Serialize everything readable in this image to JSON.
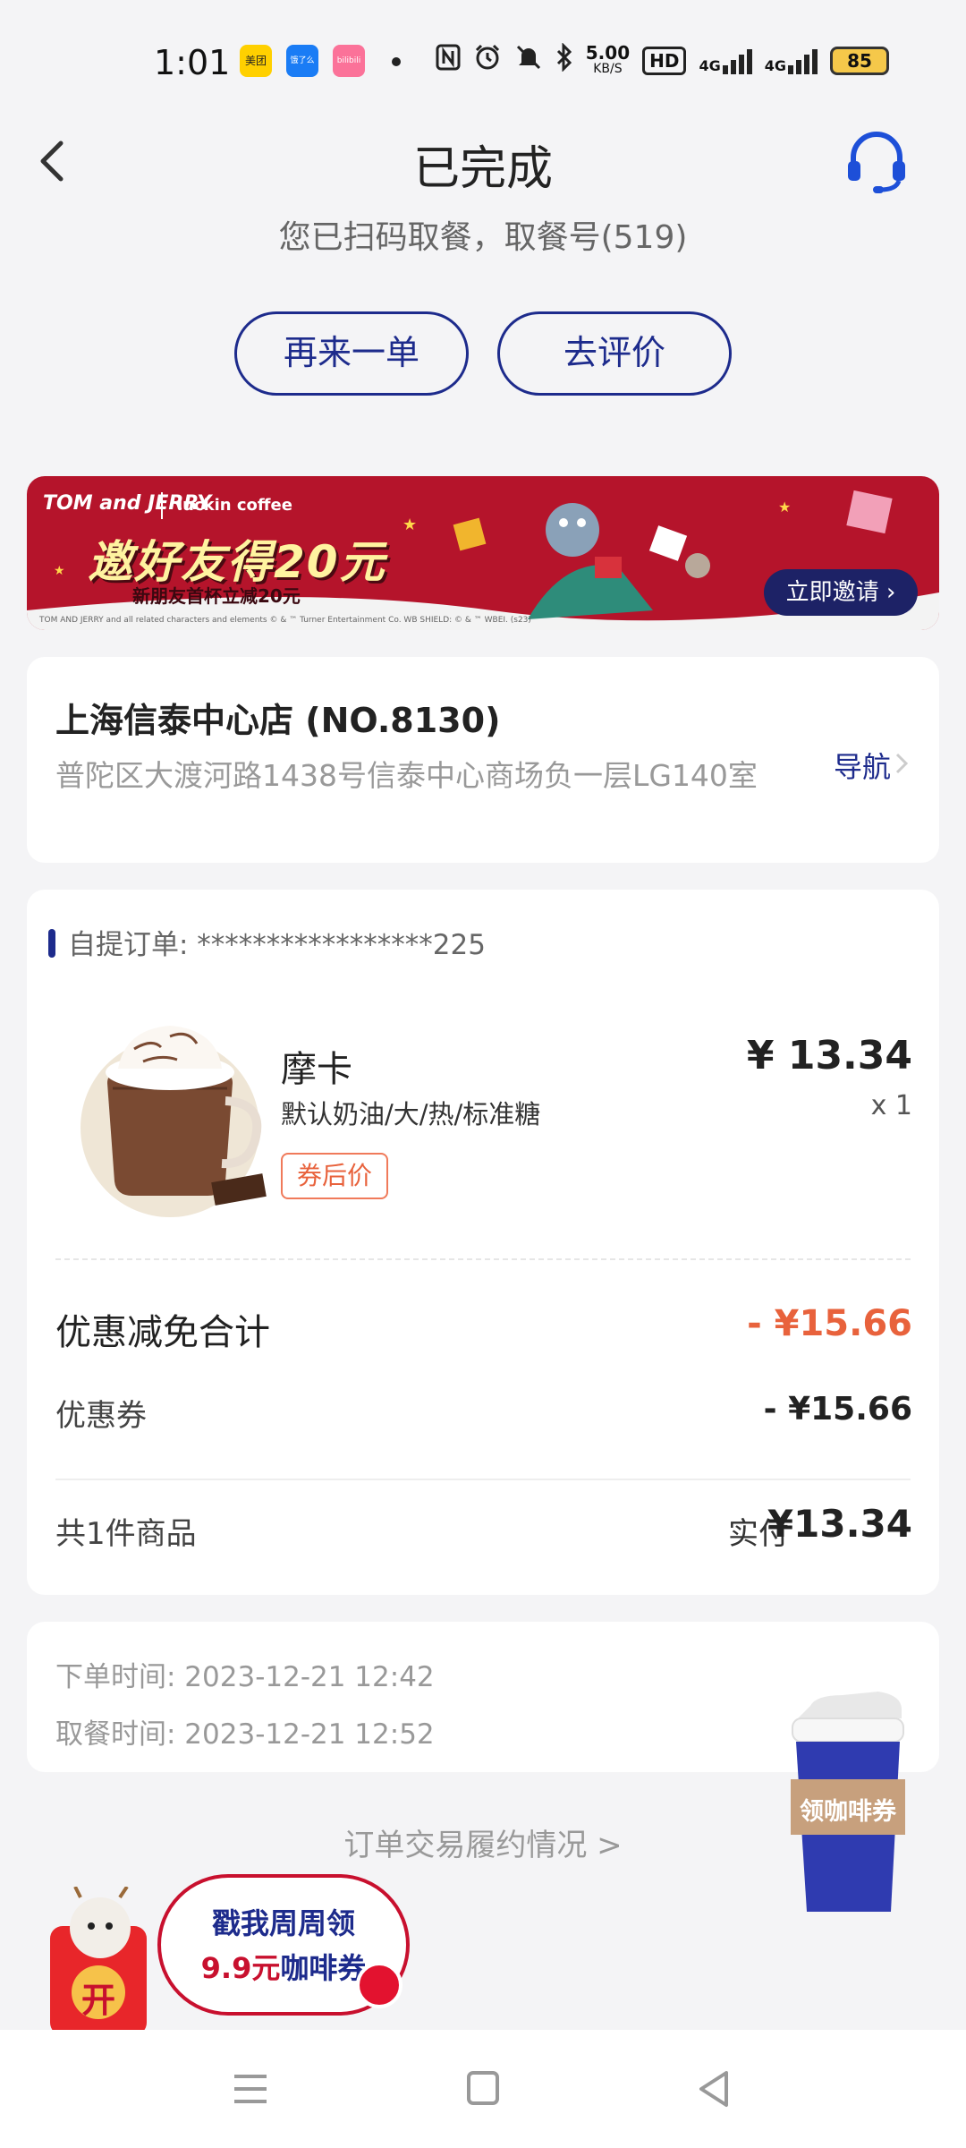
{
  "status_bar": {
    "time": "1:01",
    "apps": [
      "美团",
      "饿了么",
      "bilibili"
    ],
    "net_speed_value": "5.00",
    "net_speed_unit": "KB/S",
    "hd_label": "HD",
    "signal1": "4G",
    "signal2": "4G",
    "battery": "85"
  },
  "header": {
    "title": "已完成",
    "subtitle": "您已扫码取餐，取餐号(519)",
    "reorder_label": "再来一单",
    "review_label": "去评价"
  },
  "banner": {
    "brand_left": "TOM and JERRY",
    "brand_right": "luckin coffee",
    "title": "邀好友得20元",
    "subtitle": "新朋友首杯立减20元",
    "cta": "立即邀请",
    "legal": "TOM AND JERRY and all related characters and elements © & ™ Turner Entertainment Co. WB SHIELD: © & ™ WBEI. (s23)"
  },
  "store": {
    "name": "上海信泰中心店 (NO.8130)",
    "address": "普陀区大渡河路1438号信泰中心商场负一层LG140室",
    "nav_label": "导航"
  },
  "order": {
    "label": "自提订单: *****************225",
    "product": {
      "name": "摩卡",
      "spec": "默认奶油/大/热/标准糖",
      "tag": "券后价",
      "price": "¥ 13.34",
      "qty": "x 1"
    },
    "discount_total_label": "优惠减免合计",
    "discount_total_value": "- ¥15.66",
    "coupon_label": "优惠券",
    "coupon_value": "- ¥15.66",
    "item_count": "共1件商品",
    "paid_label": "实付",
    "paid_value": "¥13.34"
  },
  "times": {
    "order_time": "下单时间:  2023-12-21 12:42",
    "pickup_time": "取餐时间:  2023-12-21 12:52"
  },
  "fulfil_link": "订单交易履约情况 >",
  "cup_widget": {
    "label": "领咖啡券"
  },
  "promo_widget": {
    "line1": "戳我周周领",
    "line2_price": "9.9元",
    "line2_rest": "咖啡券",
    "gift_char": "开"
  },
  "colors": {
    "brand_blue": "#1d2b8c",
    "discount_red": "#e8623c",
    "banner_red": "#b5142b"
  }
}
